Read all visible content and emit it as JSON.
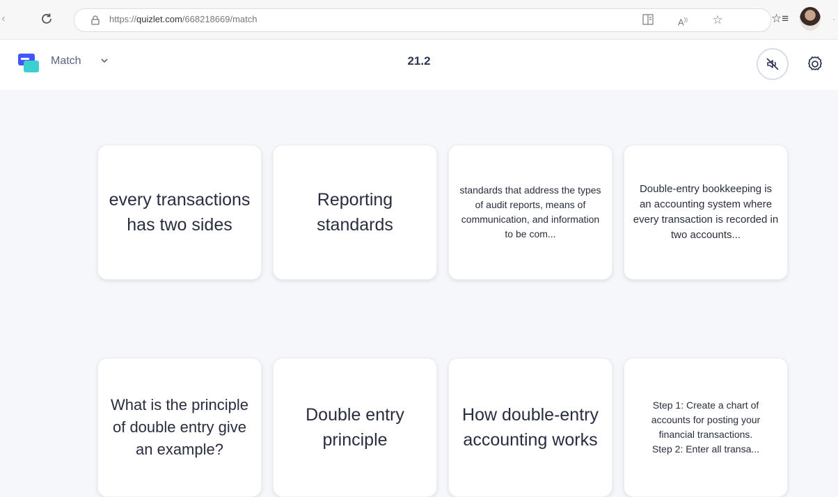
{
  "browser": {
    "url_prefix": "https://",
    "url_domain": "quizlet.com",
    "url_path": "/668218669/match"
  },
  "header": {
    "mode_label": "Match",
    "timer": "21.2"
  },
  "colors": {
    "brand_blue": "#4255ff",
    "brand_teal": "#3ccfcf",
    "text_dark": "#282e3e",
    "background": "#f6f7fb"
  },
  "cards": [
    {
      "text": "every transactions has two sides"
    },
    {
      "text": "Reporting standards"
    },
    {
      "text": "standards that address the types of audit reports, means of communication, and information to be com..."
    },
    {
      "text": "Double-entry bookkeeping is an accounting system where every transaction is recorded in two accounts..."
    },
    {
      "text": "What is the principle of double entry give an example?"
    },
    {
      "text": "Double entry principle"
    },
    {
      "text": "How double-entry accounting works"
    },
    {
      "text": "Step 1: Create a chart of accounts for posting your financial transactions.\nStep 2: Enter all transa..."
    }
  ]
}
